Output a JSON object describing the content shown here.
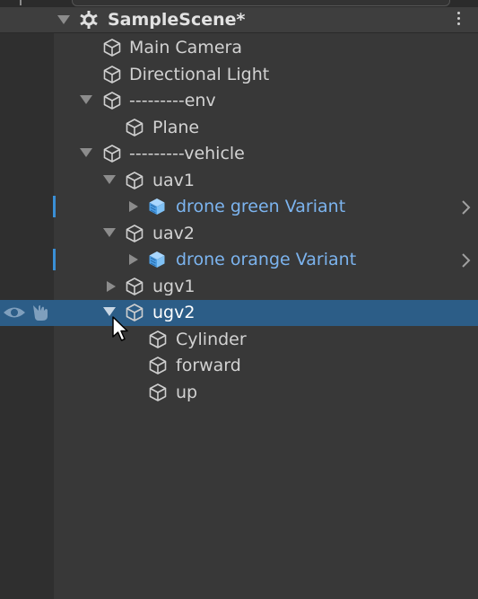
{
  "scene": {
    "title": "SampleScene*"
  },
  "hierarchy": {
    "items": [
      {
        "label": "Main Camera"
      },
      {
        "label": "Directional Light"
      },
      {
        "label": "---------env"
      },
      {
        "label": "Plane"
      },
      {
        "label": "---------vehicle"
      },
      {
        "label": "uav1"
      },
      {
        "label": "drone green Variant"
      },
      {
        "label": "uav2"
      },
      {
        "label": "drone orange Variant"
      },
      {
        "label": "ugv1"
      },
      {
        "label": "ugv2"
      },
      {
        "label": "Cylinder"
      },
      {
        "label": "forward"
      },
      {
        "label": "up"
      }
    ]
  },
  "colors": {
    "background": "#383838",
    "selection": "#2c5d87",
    "prefab_text": "#7cb4ef",
    "change_marker": "#3a8fd6"
  },
  "icons": [
    "unity-scene-icon",
    "gameobject-cube-icon",
    "prefab-cube-icon",
    "visibility-eye-icon",
    "pickable-hand-icon",
    "more-options-icon",
    "chevron-right-icon",
    "mouse-cursor-icon"
  ]
}
